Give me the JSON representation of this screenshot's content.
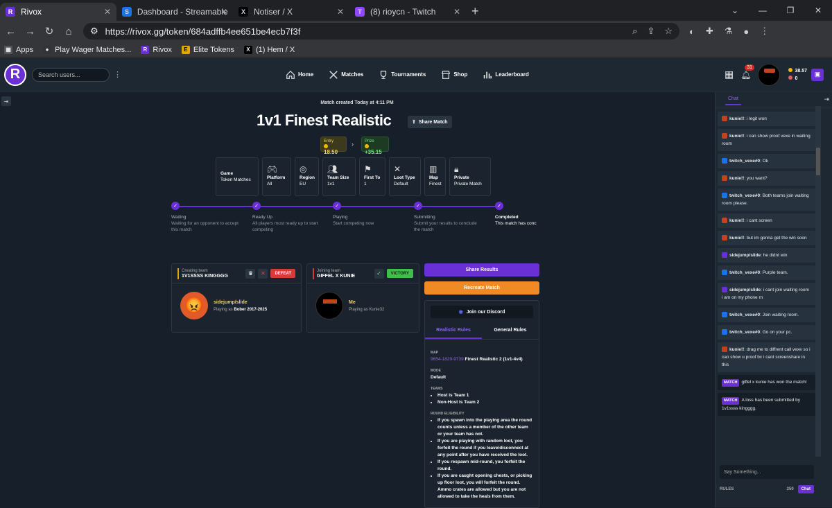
{
  "browser": {
    "tabs": [
      {
        "label": "Rivox",
        "active": true
      },
      {
        "label": "Dashboard - Streamable",
        "active": false
      },
      {
        "label": "Notiser / X",
        "active": false
      },
      {
        "label": "(8) rioycn - Twitch",
        "active": false
      }
    ],
    "url": "https://rivox.gg/token/684adffb4ee651be4ecb7f3f",
    "bookmarks": [
      "Apps",
      "Play Wager Matches...",
      "Rivox",
      "Elite Tokens",
      "(1) Hem / X"
    ]
  },
  "header": {
    "logo_letter": "R",
    "search_placeholder": "Search users...",
    "nav": [
      {
        "label": "Home",
        "icon": "home-icon"
      },
      {
        "label": "Matches",
        "icon": "swords-icon"
      },
      {
        "label": "Tournaments",
        "icon": "trophy-icon"
      },
      {
        "label": "Shop",
        "icon": "shop-icon"
      },
      {
        "label": "Leaderboard",
        "icon": "chart-icon"
      }
    ],
    "notifications": "31",
    "balance_tokens": "38.57",
    "balance_gems": "0"
  },
  "match": {
    "created": "Match created Today at 4:11 PM",
    "title": "1v1 Finest Realistic",
    "share_label": "Share Match",
    "entry_label": "Entry",
    "entry_value": "18.50",
    "prize_label": "Prize",
    "prize_value": "+35.15",
    "cards": [
      {
        "label": "Game",
        "value": "Token Matches",
        "icon": ""
      },
      {
        "label": "Platform",
        "value": "All",
        "icon": "gamepad-icon"
      },
      {
        "label": "Region",
        "value": "EU",
        "icon": "globe-icon"
      },
      {
        "label": "Team Size",
        "value": "1v1",
        "icon": "users-icon"
      },
      {
        "label": "First To",
        "value": "1",
        "icon": "flag-icon"
      },
      {
        "label": "Loot Type",
        "value": "Default",
        "icon": "swords-icon"
      },
      {
        "label": "Map",
        "value": "Finest",
        "icon": "map-icon"
      },
      {
        "label": "Private",
        "value": "Private Match",
        "icon": "lock-icon"
      }
    ],
    "steps": [
      {
        "name": "Waiting",
        "desc": "Waiting for an opponent to accept this match"
      },
      {
        "name": "Ready Up",
        "desc": "All players must ready up to start competing"
      },
      {
        "name": "Playing",
        "desc": "Start competing now"
      },
      {
        "name": "Submitting",
        "desc": "Submit your results to conclude the match"
      },
      {
        "name": "Completed",
        "desc": "This match has conc"
      }
    ],
    "team1": {
      "role": "Creating team",
      "name": "1V1SSSS KINGGGG",
      "result": "DEFEAT",
      "player": "sidejump/slide",
      "playing_as_label": "Playing as",
      "playing_as": "Bober 2017-2025"
    },
    "team2": {
      "role": "Joining team",
      "name": "GIFFEL X KUNIE",
      "result": "VICTORY",
      "player": "Me",
      "playing_as_label": "Playing as",
      "playing_as": "Kunie32"
    },
    "share_results": "Share Results",
    "recreate": "Recreate Match"
  },
  "rules": {
    "discord": "Join our Discord",
    "tabs": [
      "Realistic Rules",
      "General Rules"
    ],
    "map_label": "MAP",
    "map_code": "9654-1829-9739",
    "map_name": "Finest Realistic 2 (1v1-4v4)",
    "mode_label": "MODE",
    "mode": "Default",
    "teams_label": "TEAMS",
    "teams": [
      "Host is Team 1",
      "Non-Host is Team 2"
    ],
    "round_label": "ROUND ELIGIBILITY",
    "round_rules": [
      "If you spawn into the playing area the round counts unless a member of the other team or your team has not.",
      "If you are playing with random loot, you forfeit the round if you leave/disconnect at any point after you have received the loot.",
      "If you respawn mid-round, you forfeit the round.",
      "If you are caught opening chests, or picking up floor loot, you will forfeit the round. Ammo crates are allowed but you are not allowed to take the heals from them."
    ]
  },
  "chat": {
    "tab": "Chat",
    "messages": [
      {
        "user": "kunie!!",
        "text": "i legit won",
        "type": "user"
      },
      {
        "user": "kunie!!",
        "text": "i can show proof vexe in waiting room",
        "type": "user"
      },
      {
        "user": "twitch_vexe#0",
        "text": "Ok",
        "type": "mod"
      },
      {
        "user": "kunie!!",
        "text": "you want?",
        "type": "user"
      },
      {
        "user": "twitch_vexe#0",
        "text": "Both teams join waiting room please.",
        "type": "mod"
      },
      {
        "user": "kunie!!",
        "text": "i cant screen",
        "type": "user"
      },
      {
        "user": "kunie!!",
        "text": "but im gonna get the win soon",
        "type": "user"
      },
      {
        "user": "sidejump/slide",
        "text": "he didnt win",
        "type": "user2"
      },
      {
        "user": "twitch_vexe#0",
        "text": "Purple team.",
        "type": "mod"
      },
      {
        "user": "sidejump/slide",
        "text": "i cant join waiting room i am on my phone rn",
        "type": "user2"
      },
      {
        "user": "twitch_vexe#0",
        "text": "Join waiting room.",
        "type": "mod"
      },
      {
        "user": "twitch_vexe#0",
        "text": "Go on your pc.",
        "type": "mod"
      },
      {
        "user": "kunie!!",
        "text": "drag me to diffrent call vexe so i can show u proof bc i cant screenshare in this",
        "type": "user"
      },
      {
        "user": "MATCH",
        "text": "giffel x kunie has won the match!",
        "type": "system"
      },
      {
        "user": "MATCH",
        "text": "A loss has been submitted by 1v1ssss kingggg.",
        "type": "system"
      }
    ],
    "input_placeholder": "Say Something...",
    "rules_label": "RULES",
    "char_count": "250",
    "send_label": "Chat"
  }
}
